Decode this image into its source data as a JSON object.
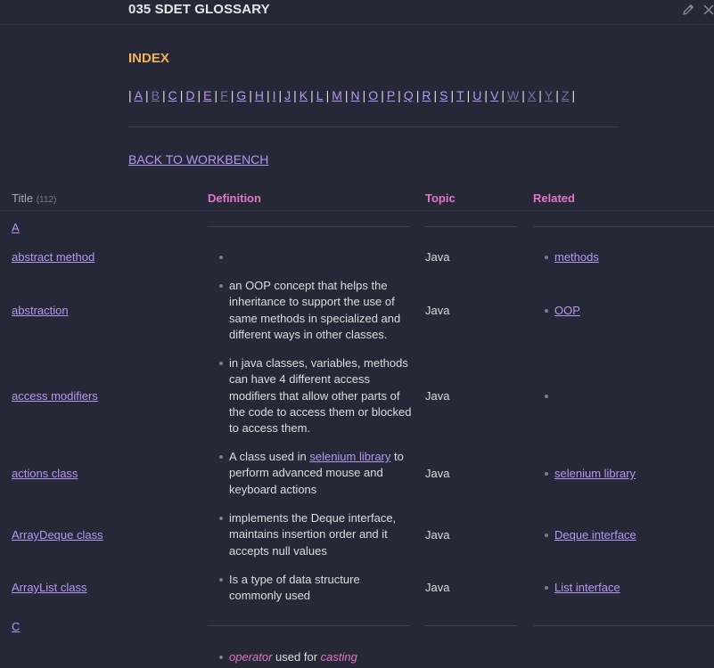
{
  "header": {
    "title": "035 SDET GLOSSARY",
    "edit_icon": "pencil-icon",
    "close_icon": "close-icon"
  },
  "index": {
    "heading": "INDEX",
    "letters": [
      "A",
      "B",
      "C",
      "D",
      "E",
      "F",
      "G",
      "H",
      "I",
      "J",
      "K",
      "L",
      "M",
      "N",
      "O",
      "P",
      "Q",
      "R",
      "S",
      "T",
      "U",
      "V",
      "W",
      "X",
      "Y",
      "Z"
    ],
    "dim_letters": [
      "B",
      "F",
      "W",
      "X",
      "Y",
      "Z"
    ]
  },
  "back_link": "BACK TO WORKBENCH",
  "table": {
    "columns": {
      "title": "Title",
      "count": "(112)",
      "definition": "Definition",
      "topic": "Topic",
      "related": "Related"
    },
    "rows": [
      {
        "type": "letter",
        "title": "A"
      },
      {
        "type": "entry",
        "title": "abstract method",
        "definition": "",
        "topic": "Java",
        "related": "methods"
      },
      {
        "type": "entry",
        "title": "abstraction",
        "definition": "an OOP concept that helps the inheritance to support the use of same methods in specialized and different ways in other classes.",
        "topic": "Java",
        "related": "OOP"
      },
      {
        "type": "entry",
        "title": "access modifiers",
        "definition": "in java classes, variables, methods can have 4 different access modifiers that allow other parts of the code to access them or blocked to access them.",
        "topic": "Java",
        "related": ""
      },
      {
        "type": "entry",
        "title": "actions class",
        "definition_pre": "A class used in",
        "definition_link": "selenium library",
        "definition_post": "to perform advanced mouse and keyboard actions",
        "topic": "Java",
        "related": "selenium library"
      },
      {
        "type": "entry",
        "title": "ArrayDeque class",
        "definition": "implements the Deque interface, maintains insertion order and it accepts null values",
        "topic": "Java",
        "related": "Deque interface"
      },
      {
        "type": "entry",
        "title": "ArrayList class",
        "definition": "Is a type of data structure commonly used",
        "topic": "Java",
        "related": "List interface"
      },
      {
        "type": "letter",
        "title": "C"
      },
      {
        "type": "partial",
        "definition_em1": "operator",
        "definition_mid": "used for",
        "definition_em2": "casting"
      }
    ]
  }
}
